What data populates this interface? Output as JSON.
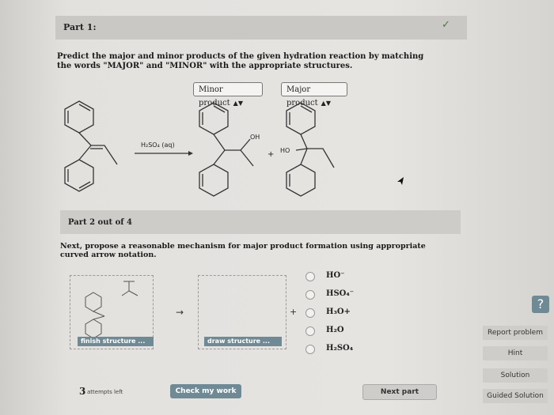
{
  "part1": {
    "title": "Part 1:",
    "question": "Predict the major and minor products of the given hydration reaction by matching the words \"MAJOR\" and \"MINOR\" with the appropriate structures.",
    "minor_select": "Minor product",
    "major_select": "Major product",
    "reagent": "H₂SO₄ (aq)",
    "oh_label": "OH",
    "ho_label": "HO",
    "plus": "+"
  },
  "part2": {
    "title": "Part 2 out of 4",
    "question": "Next, propose a reasonable mechanism for major product formation using appropriate curved arrow notation.",
    "finish_button": "finish structure ...",
    "draw_button": "draw structure ...",
    "arrow": "→",
    "plus": "+",
    "options": [
      "HO⁻",
      "HSO₄⁻",
      "H₃O+",
      "H₂O",
      "H₂SO₄"
    ]
  },
  "sidebar": {
    "help": "?",
    "report": "Report problem",
    "hint": "Hint",
    "solution": "Solution",
    "guided": "Guided Solution"
  },
  "footer": {
    "attempts_count": "3",
    "attempts_label": "attempts left",
    "check": "Check my work",
    "next": "Next part"
  }
}
